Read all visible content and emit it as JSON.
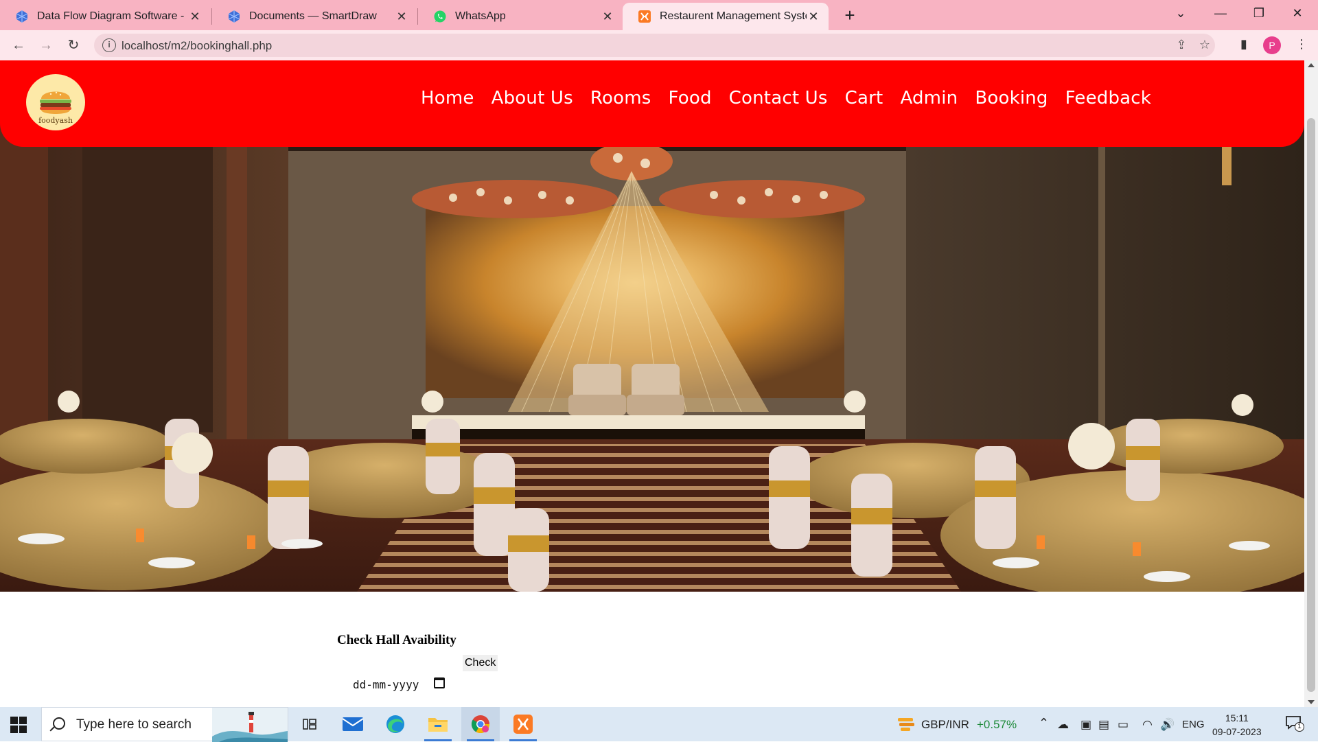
{
  "browser": {
    "tabs": [
      {
        "title": "Data Flow Diagram Software - Fr",
        "icon": "smartdraw-icon",
        "active": false
      },
      {
        "title": "Documents — SmartDraw",
        "icon": "smartdraw-icon",
        "active": false
      },
      {
        "title": "WhatsApp",
        "icon": "whatsapp-icon",
        "active": false
      },
      {
        "title": "Restaurent Management System",
        "icon": "xampp-icon",
        "active": true
      }
    ],
    "url": "localhost/m2/bookinghall.php",
    "profile_initial": "P"
  },
  "site": {
    "logo_text": "foodyash",
    "nav": [
      "Home",
      "About Us",
      "Rooms",
      "Food",
      "Contact Us",
      "Cart",
      "Admin",
      "Booking",
      "Feedback"
    ],
    "accent_color": "#ff0000"
  },
  "form": {
    "title": "Check Hall Avaibility",
    "check_button": "Check",
    "date_placeholder": "dd-mm-yyyy"
  },
  "taskbar": {
    "search_placeholder": "Type here to search",
    "ticker_label": "GBP/INR",
    "ticker_change": "+0.57%",
    "language": "ENG",
    "time": "15:11",
    "date": "09-07-2023",
    "notification_count": "1"
  }
}
